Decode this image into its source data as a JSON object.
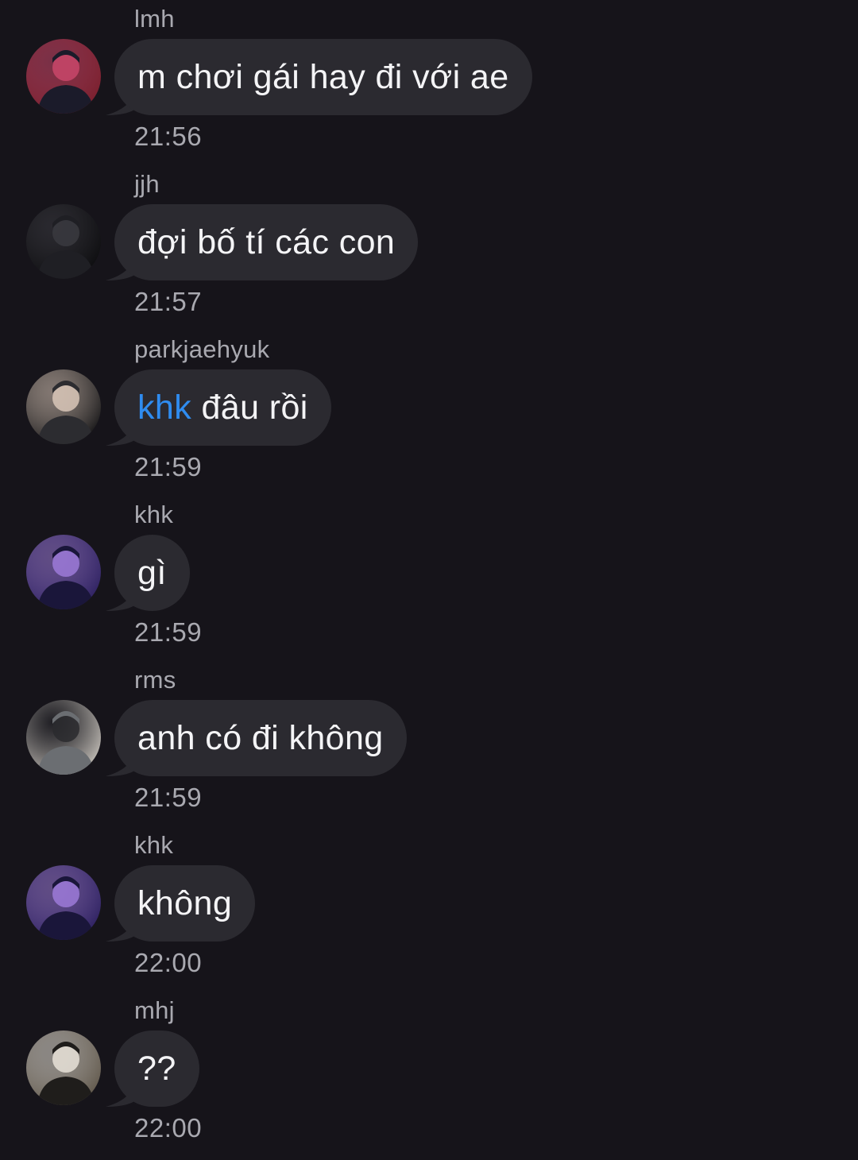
{
  "messages": [
    {
      "sender": "lmh",
      "text": "m chơi gái hay đi với ae",
      "mention": "",
      "time": "21:56",
      "avatar_icon": "user-avatar-icon",
      "avatar_colors": [
        "#7a1f2c",
        "#c9476a",
        "#1b1b2a"
      ]
    },
    {
      "sender": "jjh",
      "text": "đợi bố tí các con",
      "mention": "",
      "time": "21:57",
      "avatar_icon": "user-avatar-icon",
      "avatar_colors": [
        "#0c0c0e",
        "#3a3a40",
        "#1f1f24"
      ]
    },
    {
      "sender": "parkjaehyuk",
      "text": "đâu rồi",
      "mention": "khk",
      "time": "21:59",
      "avatar_icon": "user-avatar-icon",
      "avatar_colors": [
        "#121214",
        "#d9c7b8",
        "#2c2c30"
      ]
    },
    {
      "sender": "khk",
      "text": "gì",
      "mention": "",
      "time": "21:59",
      "avatar_icon": "user-avatar-icon",
      "avatar_colors": [
        "#2b1f5e",
        "#9c7ad8",
        "#1a163a"
      ]
    },
    {
      "sender": "rms",
      "text": "anh có đi không",
      "mention": "",
      "time": "21:59",
      "avatar_icon": "user-avatar-icon",
      "avatar_colors": [
        "#c9c4bd",
        "#2a2a2e",
        "#6b6e72"
      ]
    },
    {
      "sender": "khk",
      "text": "không",
      "mention": "",
      "time": "22:00",
      "avatar_icon": "user-avatar-icon",
      "avatar_colors": [
        "#2b1f5e",
        "#9c7ad8",
        "#1a163a"
      ]
    },
    {
      "sender": "mhj",
      "text": "??",
      "mention": "",
      "time": "22:00",
      "avatar_icon": "user-avatar-icon",
      "avatar_colors": [
        "#5e5548",
        "#e7e2d8",
        "#1f1d1b"
      ]
    }
  ],
  "colors": {
    "background": "#16141a",
    "bubble": "#2b2a30",
    "mention": "#2f8cf0",
    "meta_text": "#a9a9b0"
  }
}
